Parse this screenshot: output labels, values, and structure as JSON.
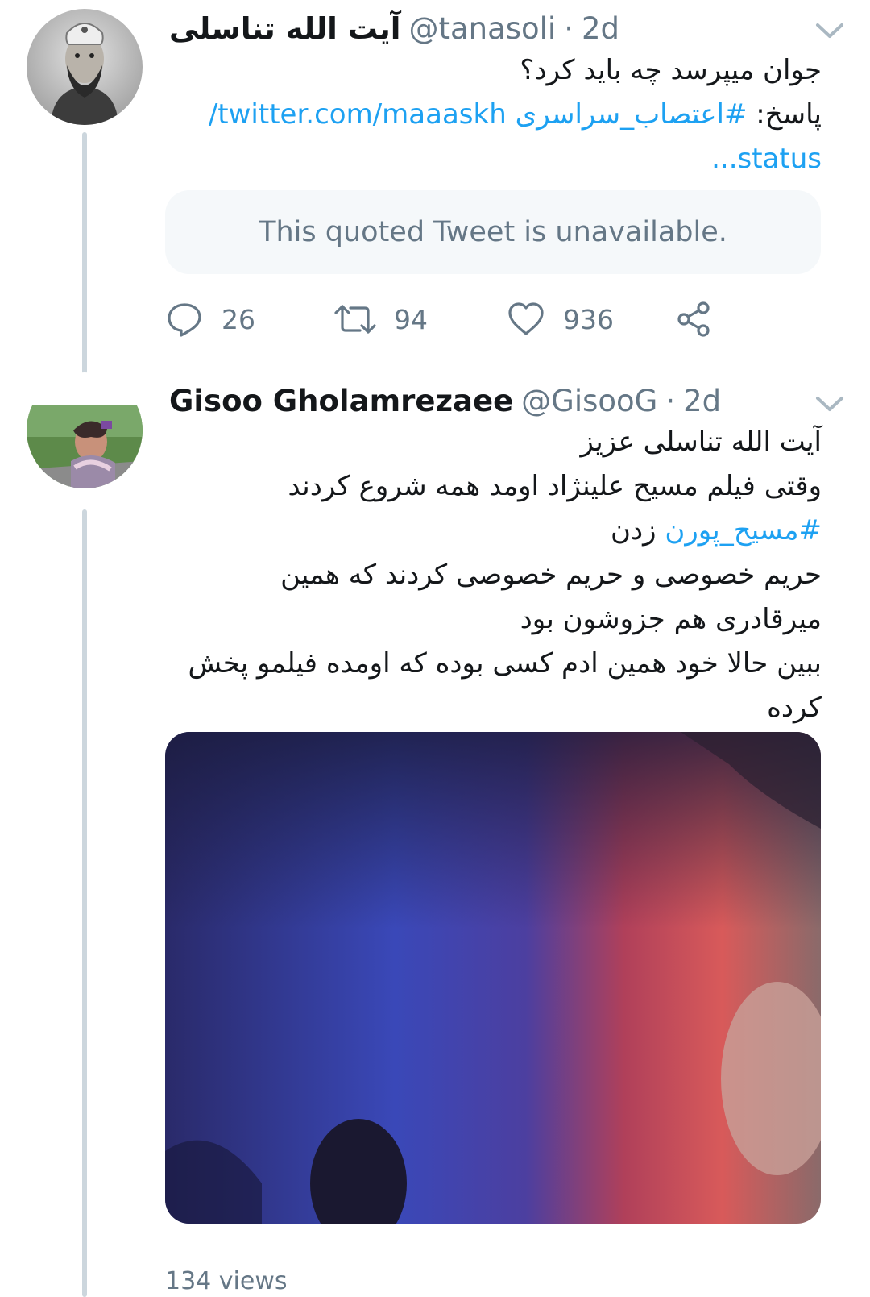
{
  "tweets": [
    {
      "display_name": "آیت الله تناسلی",
      "handle": "@tanasoli",
      "separator": "·",
      "time": "2d",
      "text_line1": "جوان میپرسد چه باید کرد؟",
      "reply_prefix": "پاسخ: ",
      "hashtag": "#اعتصاب_سراسری",
      "link_part1": " twitter.com/maaaskh/",
      "link_part2": "status...",
      "quoted_unavailable": "This quoted Tweet is unavailable.",
      "replies": "26",
      "retweets": "94",
      "likes": "936"
    },
    {
      "display_name": "Gisoo Gholamrezaee",
      "handle": "@GisooG",
      "separator": "·",
      "time": "2d",
      "lines": [
        "آیت الله تناسلی عزیز",
        "وقتی فیلم مسیح علینژاد اومد همه شروع کردند"
      ],
      "hashtag": "#مسیح_پورن",
      "hashtag_suffix": " زدن",
      "lines_after": [
        "حریم خصوصی و حریم خصوصی کردند که همین",
        "میرقادری هم جزوشون بود",
        "ببین حالا خود همین ادم کسی بوده که اومده فیلمو پخش کرده"
      ],
      "views": "134 views"
    }
  ],
  "icons": {
    "reply": "reply-icon",
    "retweet": "retweet-icon",
    "like": "heart-icon",
    "share": "share-icon",
    "caret": "chevron-down-icon"
  },
  "colors": {
    "link": "#1da1f2",
    "secondary_text": "#657786",
    "thread_line": "#ccd6dd",
    "quoted_bg": "#f5f8fa"
  }
}
